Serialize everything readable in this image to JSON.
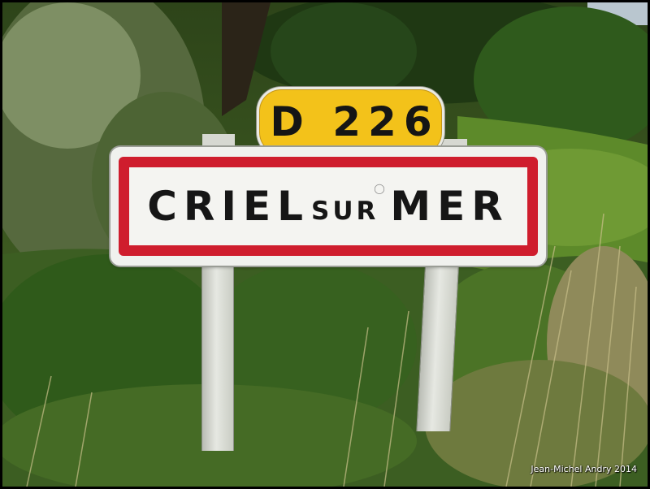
{
  "route_sign": {
    "text": "D 226",
    "color": "#f3c21a"
  },
  "town_sign": {
    "word_1": "CRIEL",
    "word_2": "SUR",
    "word_3": "MER",
    "border_color": "#cf1d2d"
  },
  "credit": "Jean-Michel Andry 2014"
}
